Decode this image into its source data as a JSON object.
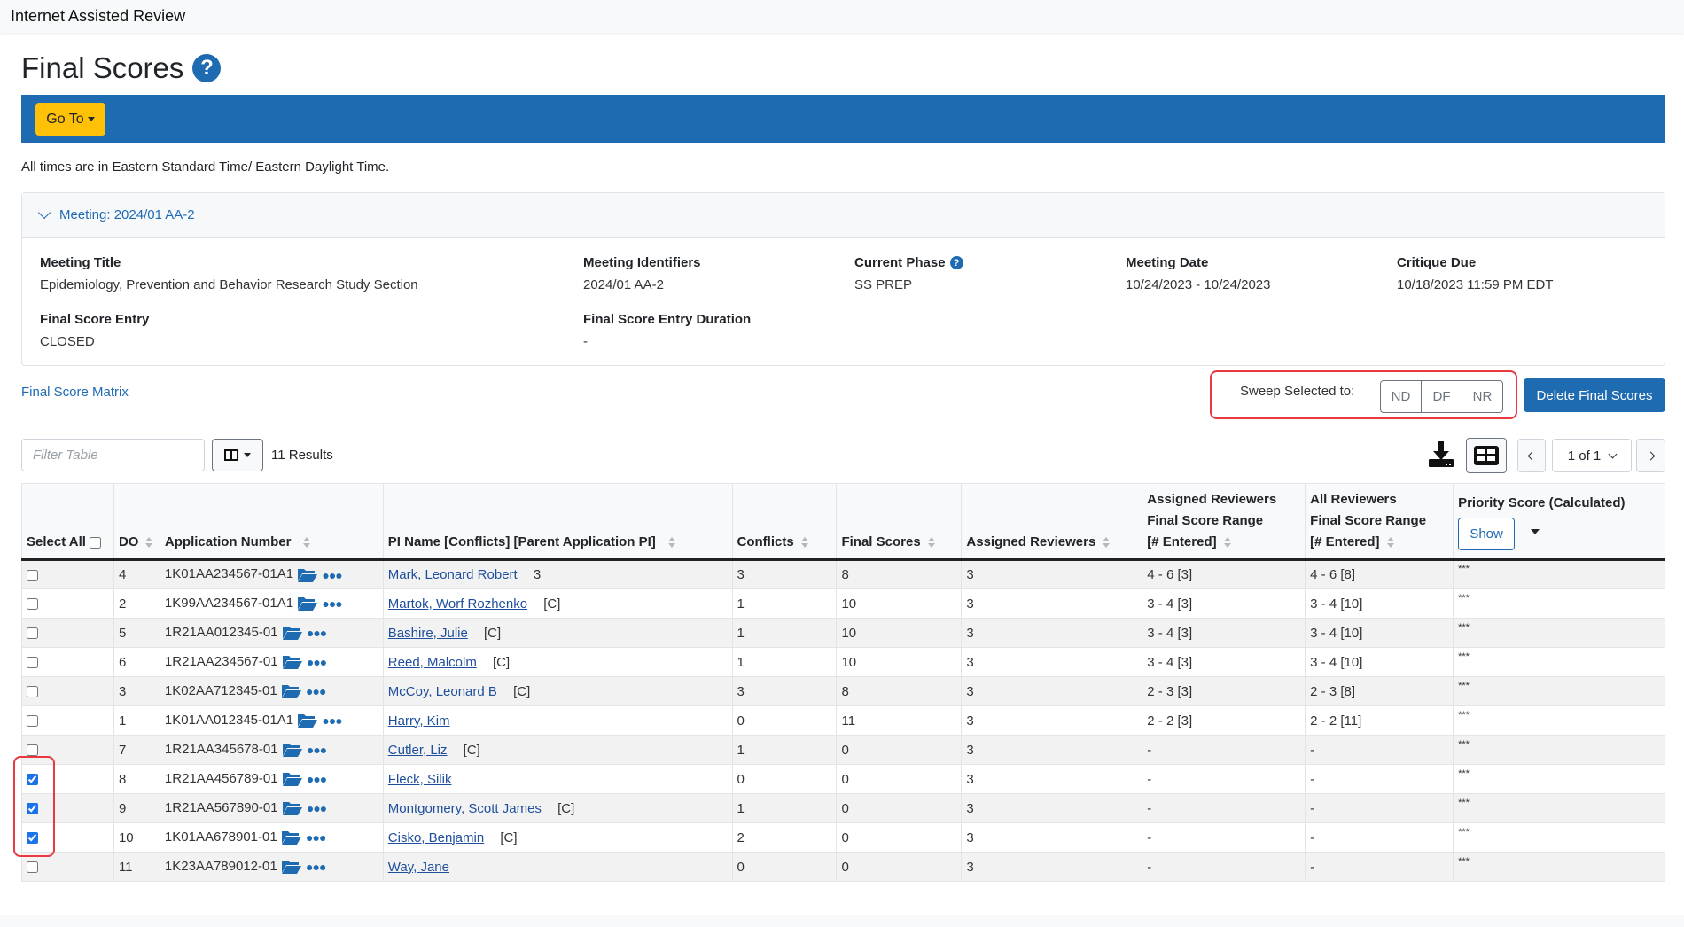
{
  "app": {
    "title": "Internet Assisted Review"
  },
  "page": {
    "title": "Final Scores",
    "help_icon": "question-circle-icon"
  },
  "toolbar": {
    "goto_label": "Go To"
  },
  "times_note": "All times are in Eastern Standard Time/ Eastern Daylight Time.",
  "meeting": {
    "header_prefix": "Meeting:",
    "header_value": "2024/01 AA-2",
    "fields": {
      "title": {
        "label": "Meeting Title",
        "value": "Epidemiology, Prevention and Behavior Research Study Section"
      },
      "identifiers": {
        "label": "Meeting Identifiers",
        "value": "2024/01 AA-2"
      },
      "phase": {
        "label": "Current Phase",
        "value": "SS PREP"
      },
      "date": {
        "label": "Meeting Date",
        "value": "10/24/2023 - 10/24/2023"
      },
      "critique_due": {
        "label": "Critique Due",
        "value": "10/18/2023 11:59 PM EDT"
      },
      "entry": {
        "label": "Final Score Entry",
        "value": "CLOSED"
      },
      "entry_duration": {
        "label": "Final Score Entry Duration",
        "value": "-"
      }
    }
  },
  "matrix_link": "Final Score Matrix",
  "sweep": {
    "label": "Sweep Selected to:",
    "options": [
      "ND",
      "DF",
      "NR"
    ]
  },
  "delete_label": "Delete Final Scores",
  "table_controls": {
    "filter_placeholder": "Filter Table",
    "results": "11 Results",
    "pagination": "1 of 1"
  },
  "table": {
    "headers": {
      "select_all": "Select All",
      "do": "DO",
      "app_number": "Application Number",
      "pi_name": "PI Name [Conflicts] [Parent Application PI]",
      "conflicts": "Conflicts",
      "final_scores": "Final Scores",
      "assigned_reviewers": "Assigned Reviewers",
      "assigned_range_1": "Assigned Reviewers",
      "assigned_range_2": "Final Score Range",
      "assigned_range_3": "[# Entered]",
      "all_range_1": "All Reviewers",
      "all_range_2": "Final Score Range",
      "all_range_3": "[# Entered]",
      "priority": "Priority Score (Calculated)",
      "show_label": "Show"
    },
    "rows": [
      {
        "checked": false,
        "do": "4",
        "app": "1K01AA234567-01A1",
        "pi": "Mark, Leonard Robert",
        "pi_note": "3",
        "conflicts": "3",
        "final": "8",
        "assigned": "3",
        "assigned_range": "4 - 6 [3]",
        "all_range": "4 - 6 [8]",
        "priority": "***"
      },
      {
        "checked": false,
        "do": "2",
        "app": "1K99AA234567-01A1",
        "pi": "Martok, Worf Rozhenko",
        "pi_note": "[C]",
        "conflicts": "1",
        "final": "10",
        "assigned": "3",
        "assigned_range": "3 - 4 [3]",
        "all_range": "3 - 4 [10]",
        "priority": "***"
      },
      {
        "checked": false,
        "do": "5",
        "app": "1R21AA012345-01",
        "pi": "Bashire, Julie",
        "pi_note": "[C]",
        "conflicts": "1",
        "final": "10",
        "assigned": "3",
        "assigned_range": "3 - 4 [3]",
        "all_range": "3 - 4 [10]",
        "priority": "***"
      },
      {
        "checked": false,
        "do": "6",
        "app": "1R21AA234567-01",
        "pi": "Reed, Malcolm",
        "pi_note": "[C]",
        "conflicts": "1",
        "final": "10",
        "assigned": "3",
        "assigned_range": "3 - 4 [3]",
        "all_range": "3 - 4 [10]",
        "priority": "***"
      },
      {
        "checked": false,
        "do": "3",
        "app": "1K02AA712345-01",
        "pi": "McCoy, Leonard B",
        "pi_note": "[C]",
        "conflicts": "3",
        "final": "8",
        "assigned": "3",
        "assigned_range": "2 - 3 [3]",
        "all_range": "2 - 3 [8]",
        "priority": "***"
      },
      {
        "checked": false,
        "do": "1",
        "app": "1K01AA012345-01A1",
        "pi": "Harry, Kim",
        "pi_note": "",
        "conflicts": "0",
        "final": "11",
        "assigned": "3",
        "assigned_range": "2 - 2 [3]",
        "all_range": "2 - 2 [11]",
        "priority": "***"
      },
      {
        "checked": false,
        "do": "7",
        "app": "1R21AA345678-01",
        "pi": "Cutler, Liz",
        "pi_note": "[C]",
        "conflicts": "1",
        "final": "0",
        "assigned": "3",
        "assigned_range": "-",
        "all_range": "-",
        "priority": "***"
      },
      {
        "checked": true,
        "do": "8",
        "app": "1R21AA456789-01",
        "pi": "Fleck, Silik",
        "pi_note": "",
        "conflicts": "0",
        "final": "0",
        "assigned": "3",
        "assigned_range": "-",
        "all_range": "-",
        "priority": "***"
      },
      {
        "checked": true,
        "do": "9",
        "app": "1R21AA567890-01",
        "pi": "Montgomery, Scott James",
        "pi_note": "[C]",
        "conflicts": "1",
        "final": "0",
        "assigned": "3",
        "assigned_range": "-",
        "all_range": "-",
        "priority": "***"
      },
      {
        "checked": true,
        "do": "10",
        "app": "1K01AA678901-01",
        "pi": "Cisko, Benjamin",
        "pi_note": "[C]",
        "conflicts": "2",
        "final": "0",
        "assigned": "3",
        "assigned_range": "-",
        "all_range": "-",
        "priority": "***"
      },
      {
        "checked": false,
        "do": "11",
        "app": "1K23AA789012-01",
        "pi": "Way, Jane",
        "pi_note": "",
        "conflicts": "0",
        "final": "0",
        "assigned": "3",
        "assigned_range": "-",
        "all_range": "-",
        "priority": "***"
      }
    ]
  },
  "colors": {
    "brand_blue": "#1f6bb2",
    "goto_yellow": "#ffc107",
    "highlight_red": "#e8393f"
  }
}
